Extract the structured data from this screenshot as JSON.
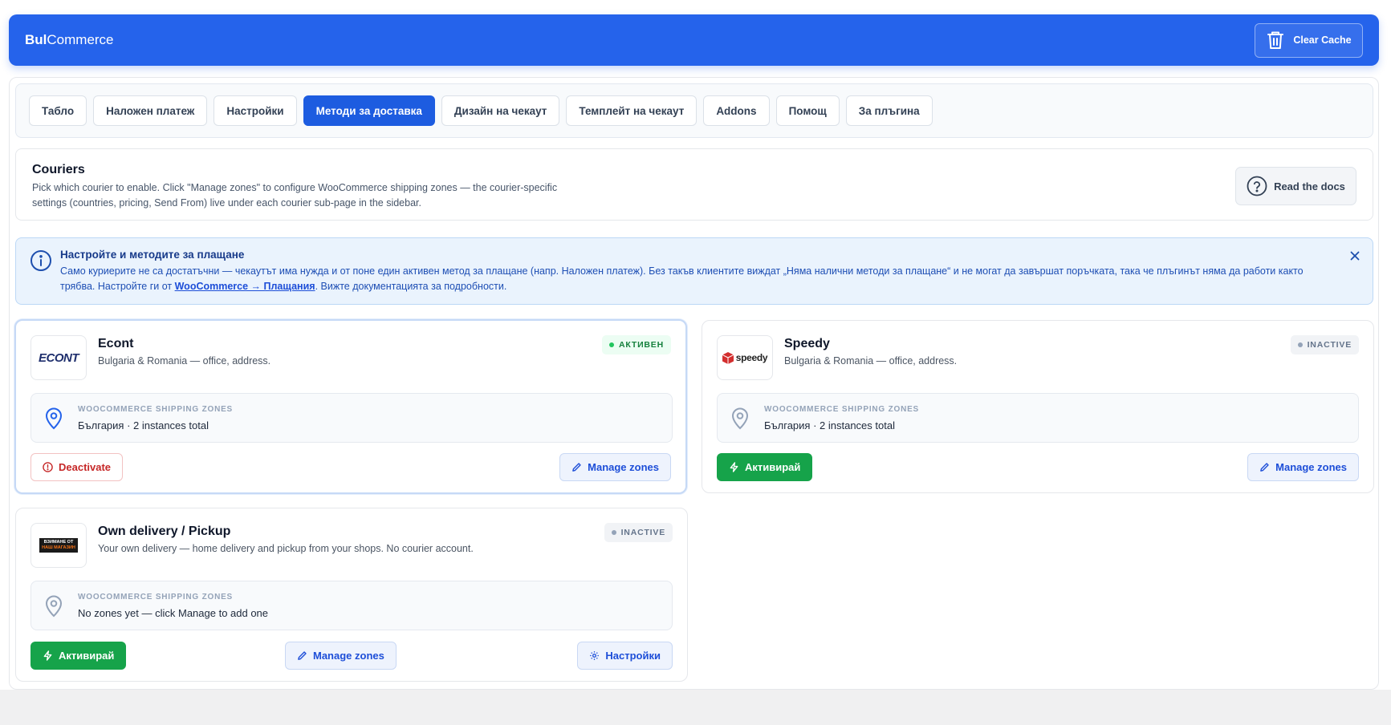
{
  "header": {
    "brand_bold": "Bul",
    "brand_rest": "Commerce",
    "clear_cache_label": "Clear Cache"
  },
  "tabs": [
    {
      "label": "Табло",
      "active": false
    },
    {
      "label": "Наложен платеж",
      "active": false
    },
    {
      "label": "Настройки",
      "active": false
    },
    {
      "label": "Методи за доставка",
      "active": true
    },
    {
      "label": "Дизайн на чекаут",
      "active": false
    },
    {
      "label": "Темплейт на чекаут",
      "active": false
    },
    {
      "label": "Addons",
      "active": false
    },
    {
      "label": "Помощ",
      "active": false
    },
    {
      "label": "За плъгина",
      "active": false
    }
  ],
  "couriers_section": {
    "title": "Couriers",
    "description": "Pick which courier to enable. Click \"Manage zones\" to configure WooCommerce shipping zones — the courier-specific settings (countries, pricing, Send From) live under each courier sub-page in the sidebar.",
    "docs_button": "Read the docs"
  },
  "info_banner": {
    "title": "Настройте и методите за плащане",
    "text_before": "Само куриерите не са достатъчни — чекаутът има нужда и от поне един активен метод за плащане (напр. Наложен платеж). Без такъв клиентите виждат „Няма налични методи за плащане“ и не могат да завършат поръчката, така че плъгинът няма да работи както трябва. Настройте ги от ",
    "link_text": "WooCommerce → Плащания",
    "text_after": ". Вижте документацията за подробности."
  },
  "couriers": {
    "econt": {
      "logo_text": "ECONT",
      "name": "Econt",
      "subtitle": "Bulgaria & Romania — office, address.",
      "status": "АКТИВЕН",
      "zones_label": "WOOCOMMERCE SHIPPING ZONES",
      "zones_value": "България · 2 instances total",
      "primary_button": "Deactivate",
      "manage_button": "Manage zones"
    },
    "speedy": {
      "logo_text": "speedy",
      "name": "Speedy",
      "subtitle": "Bulgaria & Romania — office, address.",
      "status": "INACTIVE",
      "zones_label": "WOOCOMMERCE SHIPPING ZONES",
      "zones_value": "България · 2 instances total",
      "primary_button": "Активирай",
      "manage_button": "Manage zones"
    },
    "own": {
      "logo_line1": "ВЗИМАНЕ ОТ",
      "logo_line2": "НАШ МАГАЗИН",
      "name": "Own delivery / Pickup",
      "subtitle": "Your own delivery — home delivery and pickup from your shops. No courier account.",
      "status": "INACTIVE",
      "zones_label": "WOOCOMMERCE SHIPPING ZONES",
      "zones_value": "No zones yet — click Manage to add one",
      "primary_button": "Активирай",
      "manage_button": "Manage zones",
      "settings_button": "Настройки"
    }
  },
  "colors": {
    "brand_blue": "#2563eb",
    "active_tab": "#1d5ce0",
    "success_green": "#16a34a",
    "danger_red": "#c62828"
  }
}
